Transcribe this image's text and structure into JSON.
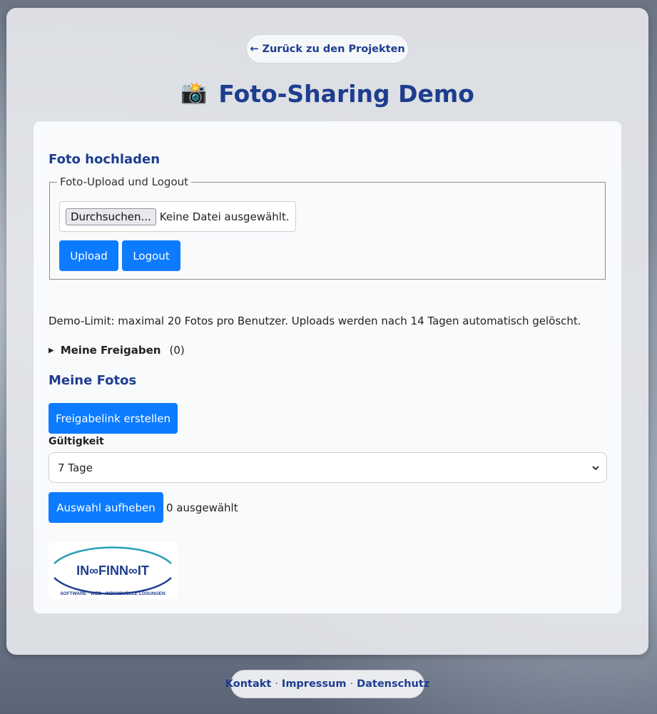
{
  "header": {
    "back_label": "← Zurück zu den Projekten",
    "title": "Foto-Sharing Demo",
    "title_icon": "📸"
  },
  "upload": {
    "heading": "Foto hochladen",
    "legend": "Foto-Upload und Logout",
    "file_button": "Durchsuchen...",
    "file_status": "Keine Datei ausgewählt.",
    "upload_label": "Upload",
    "logout_label": "Logout"
  },
  "notice": "Demo-Limit: maximal 20 Fotos pro Benutzer. Uploads werden nach 14 Tagen automatisch gelöscht.",
  "shares": {
    "label": "Meine Freigaben",
    "count": "(0)"
  },
  "photos": {
    "heading": "Meine Fotos",
    "share_button": "Freigabelink erstellen",
    "validity_label": "Gültigkeit",
    "validity_selected": "7 Tage",
    "deselect_button": "Auswahl aufheben",
    "selected_count": "0 ausgewählt"
  },
  "logo": {
    "brand_text": "IN∞FINN∞IT",
    "tagline": "SOFTWARE · WEB · INDIVIDUELLE LÖSUNGEN"
  },
  "footer": {
    "links": [
      "Kontakt",
      "Impressum",
      "Datenschutz"
    ],
    "separator": "·"
  },
  "colors": {
    "accent": "#0d7bff",
    "heading": "#1e3d8f"
  }
}
